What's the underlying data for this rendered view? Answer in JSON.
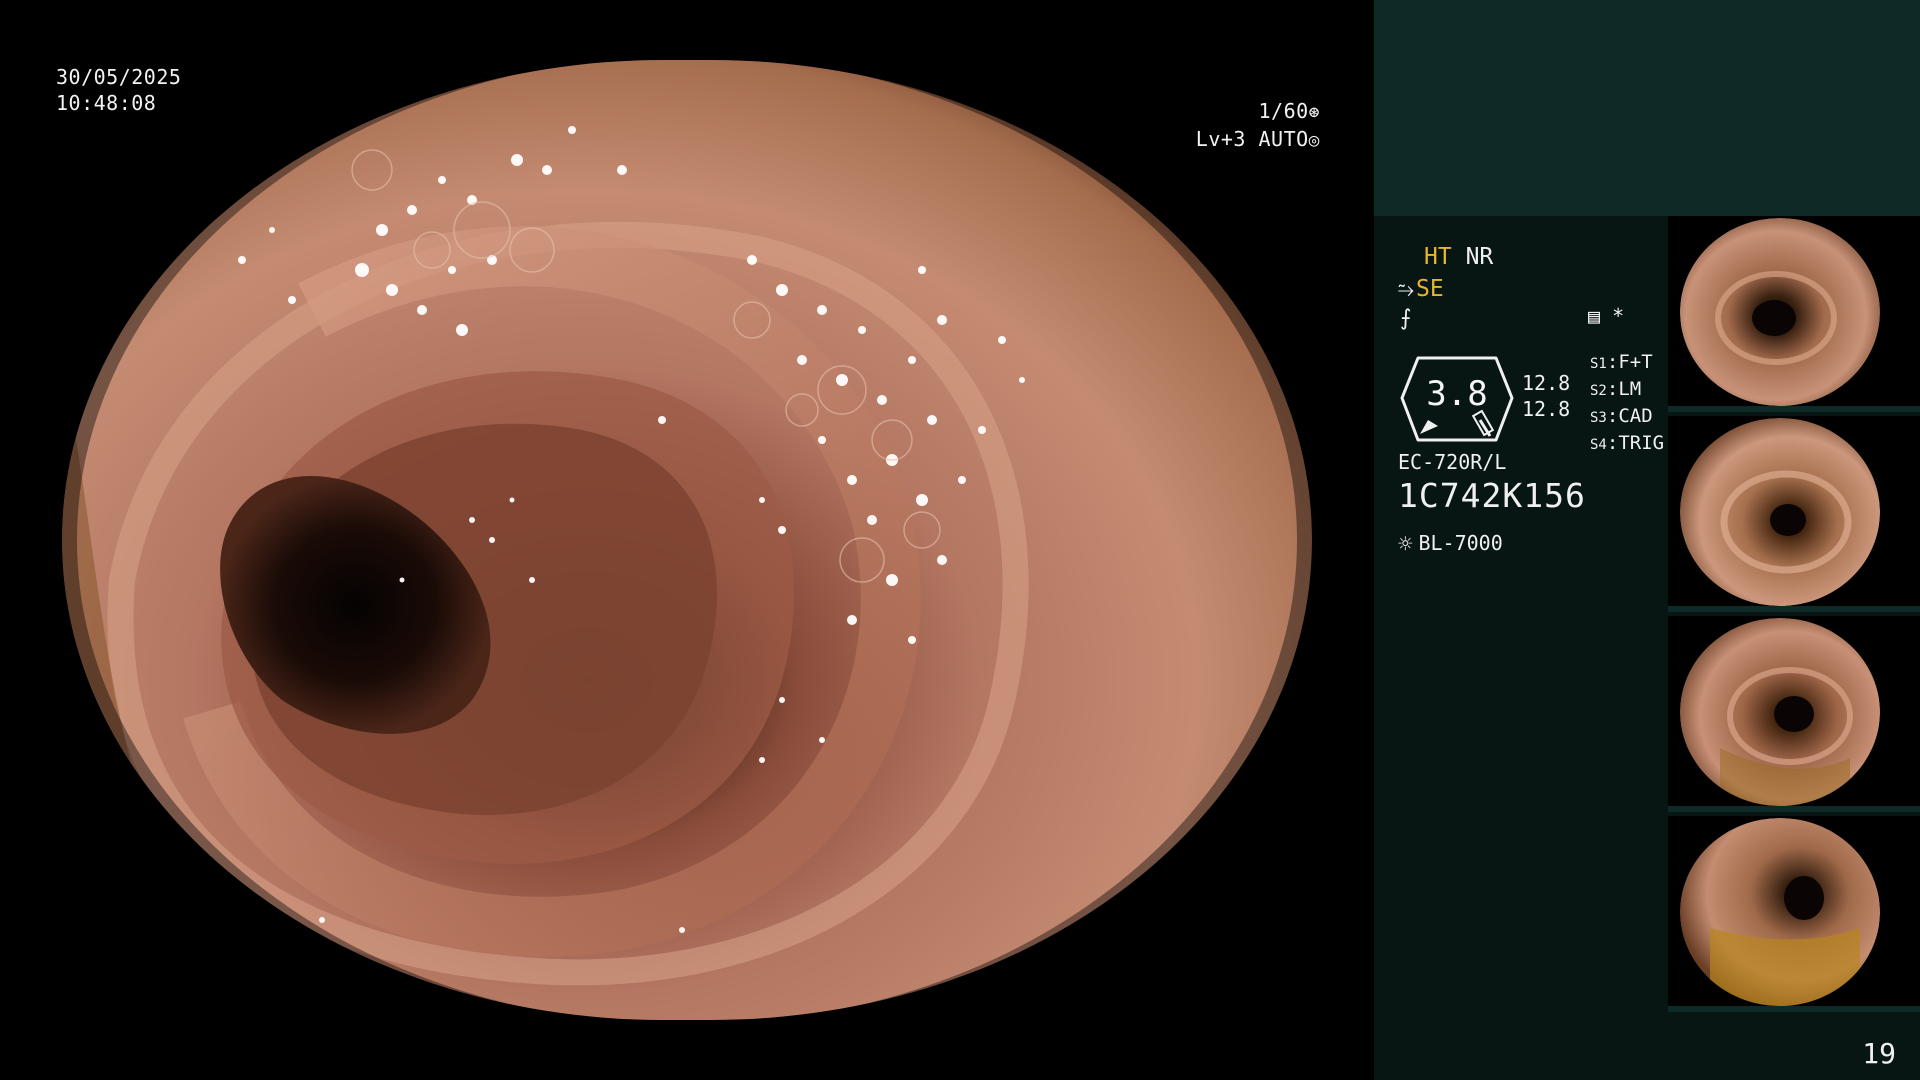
{
  "overlay": {
    "date": "30/05/2025",
    "time": "10:48:08",
    "shutter": "1/60",
    "level": "Lv+3 AUTO"
  },
  "panel": {
    "ht": "HT",
    "nr": "NR",
    "se": "SE",
    "gauge_value": "3.8",
    "gauge_sub_1": "12.8",
    "gauge_sub_2": "12.8",
    "scope_model": "EC-720R/L",
    "serial": "1C742K156",
    "light_source": "BL-7000",
    "mode_asterisk": "*",
    "switches": [
      {
        "tag": "S1",
        "label": "F+T"
      },
      {
        "tag": "S2",
        "label": "LM"
      },
      {
        "tag": "S3",
        "label": "CAD"
      },
      {
        "tag": "S4",
        "label": "TRIG"
      }
    ]
  },
  "thumbnails": [
    {
      "id": "thumb-1"
    },
    {
      "id": "thumb-2"
    },
    {
      "id": "thumb-3"
    },
    {
      "id": "thumb-4"
    }
  ],
  "page_number": "19",
  "colors": {
    "panel_bg": "#071513",
    "panel_top": "#0e2a27",
    "accent_yellow": "#e8b52e",
    "mucosa": "#b4785e"
  },
  "icons": {
    "shutter": "aperture-icon",
    "auto": "iris-icon",
    "se": "structure-enhance-icon",
    "f": "freeze-icon",
    "mode": "mode-list-icon",
    "light": "lamp-icon"
  }
}
